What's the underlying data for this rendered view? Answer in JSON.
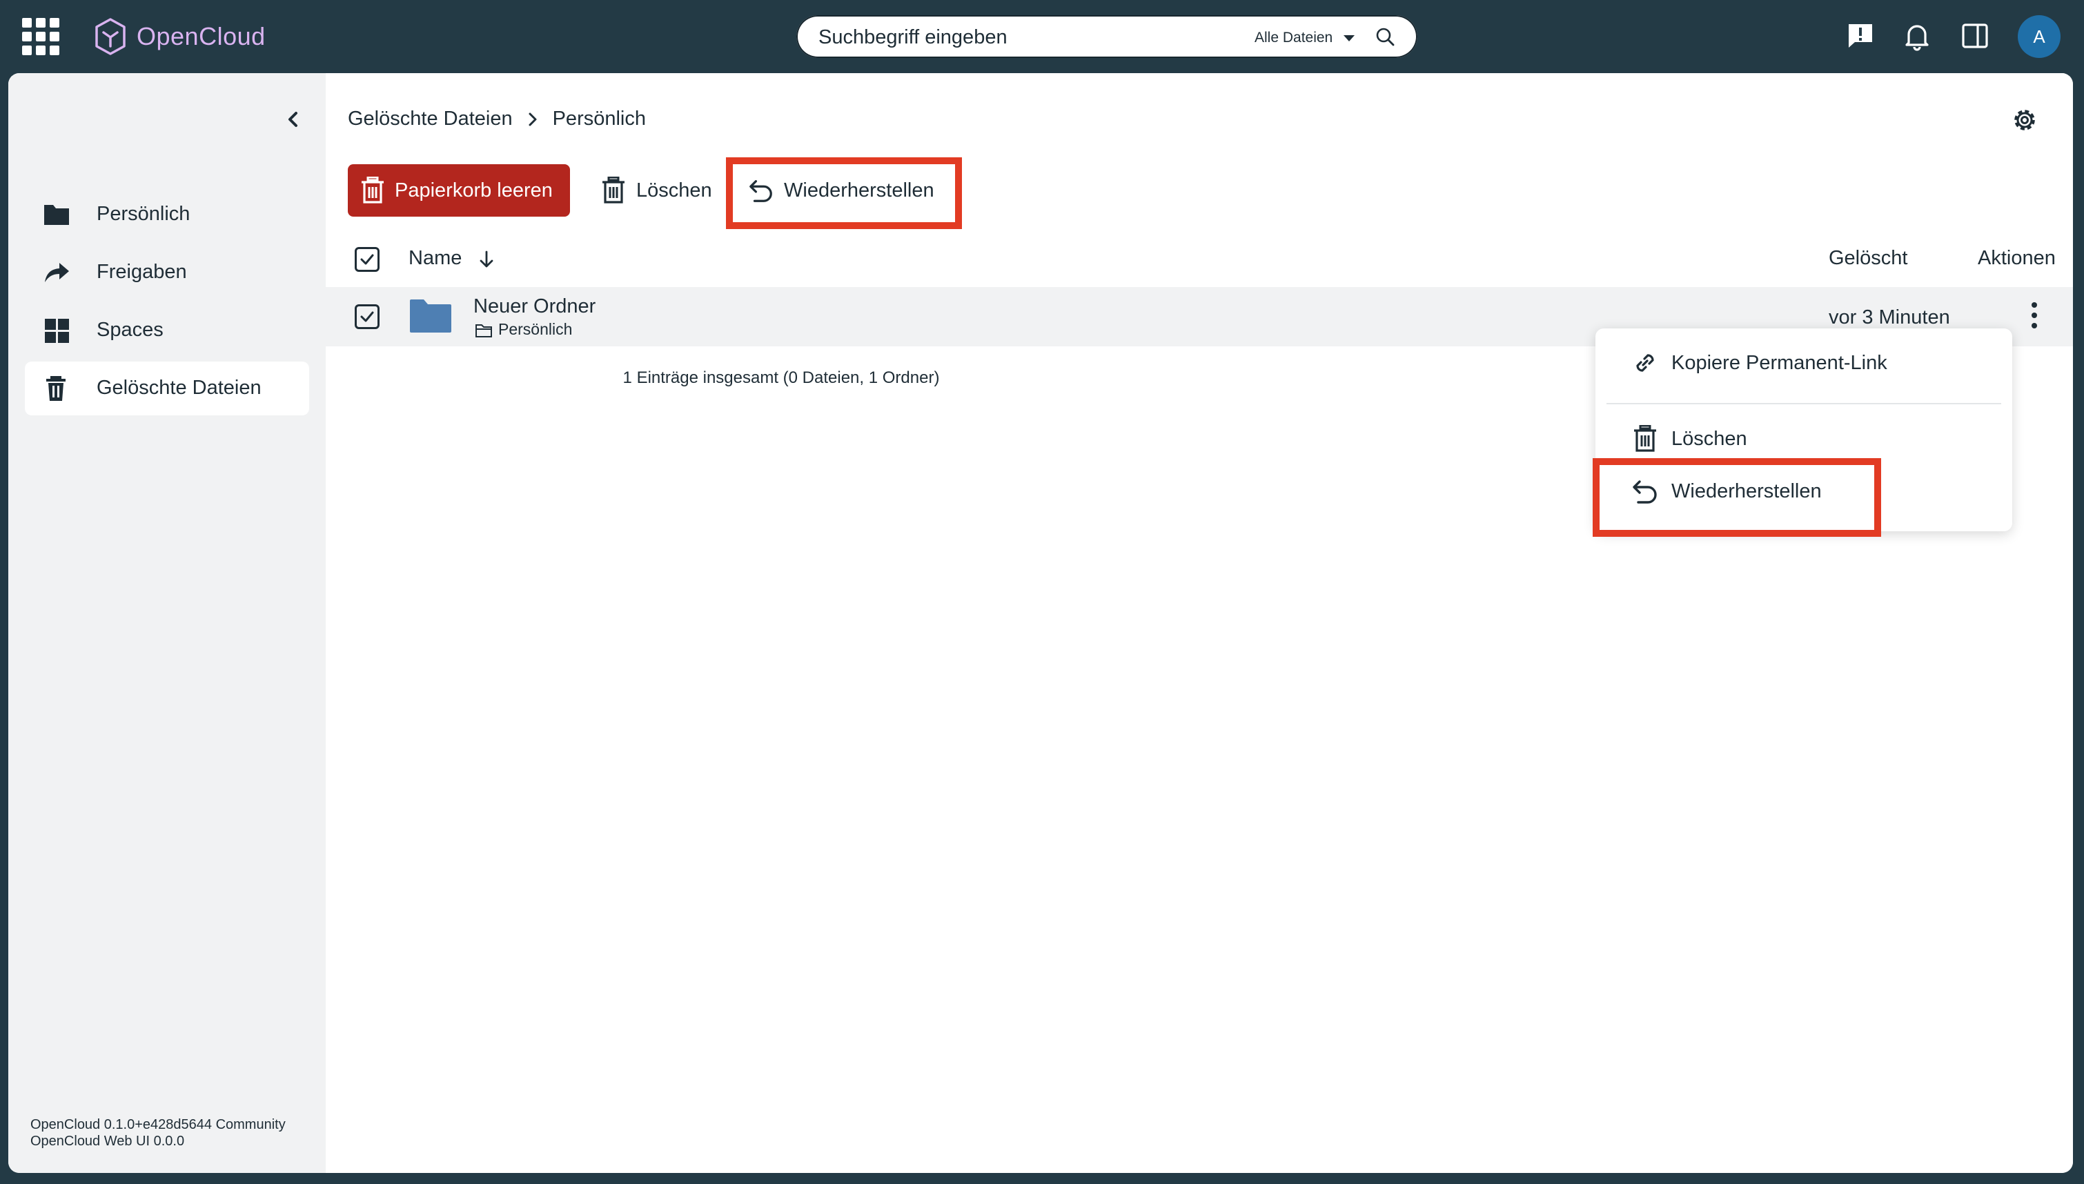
{
  "app": {
    "name": "OpenCloud"
  },
  "search": {
    "placeholder": "Suchbegriff eingeben",
    "scope": "Alle Dateien"
  },
  "user": {
    "avatar_initial": "A"
  },
  "sidebar": {
    "items": [
      {
        "label": "Persönlich",
        "icon": "folder-icon"
      },
      {
        "label": "Freigaben",
        "icon": "share-icon"
      },
      {
        "label": "Spaces",
        "icon": "spaces-icon"
      },
      {
        "label": "Gelöschte Dateien",
        "icon": "trash-icon",
        "active": true
      }
    ],
    "version_lines": [
      "OpenCloud 0.1.0+e428d5644 Community",
      "OpenCloud Web UI 0.0.0"
    ]
  },
  "breadcrumb": {
    "items": [
      "Gelöschte Dateien",
      "Persönlich"
    ]
  },
  "toolbar": {
    "empty_trash_label": "Papierkorb leeren",
    "delete_label": "Löschen",
    "restore_label": "Wiederherstellen"
  },
  "table": {
    "headers": {
      "name": "Name",
      "deleted": "Gelöscht",
      "actions": "Aktionen"
    },
    "rows": [
      {
        "name": "Neuer Ordner",
        "location": "Persönlich",
        "deleted": "vor 3 Minuten",
        "selected": true
      }
    ],
    "summary": "1 Einträge insgesamt (0 Dateien, 1 Ordner)"
  },
  "context_menu": {
    "items": [
      {
        "label": "Kopiere Permanent-Link",
        "icon": "link-icon"
      },
      {
        "label": "Löschen",
        "icon": "trash-icon"
      },
      {
        "label": "Wiederherstellen",
        "icon": "restore-icon"
      }
    ]
  },
  "colors": {
    "topbar_bg": "#233a45",
    "brand_text": "#d9b3f0",
    "danger": "#b3261e",
    "highlight": "#e23b23",
    "folder": "#4e7fb3",
    "avatar_bg": "#1f6fa8"
  }
}
